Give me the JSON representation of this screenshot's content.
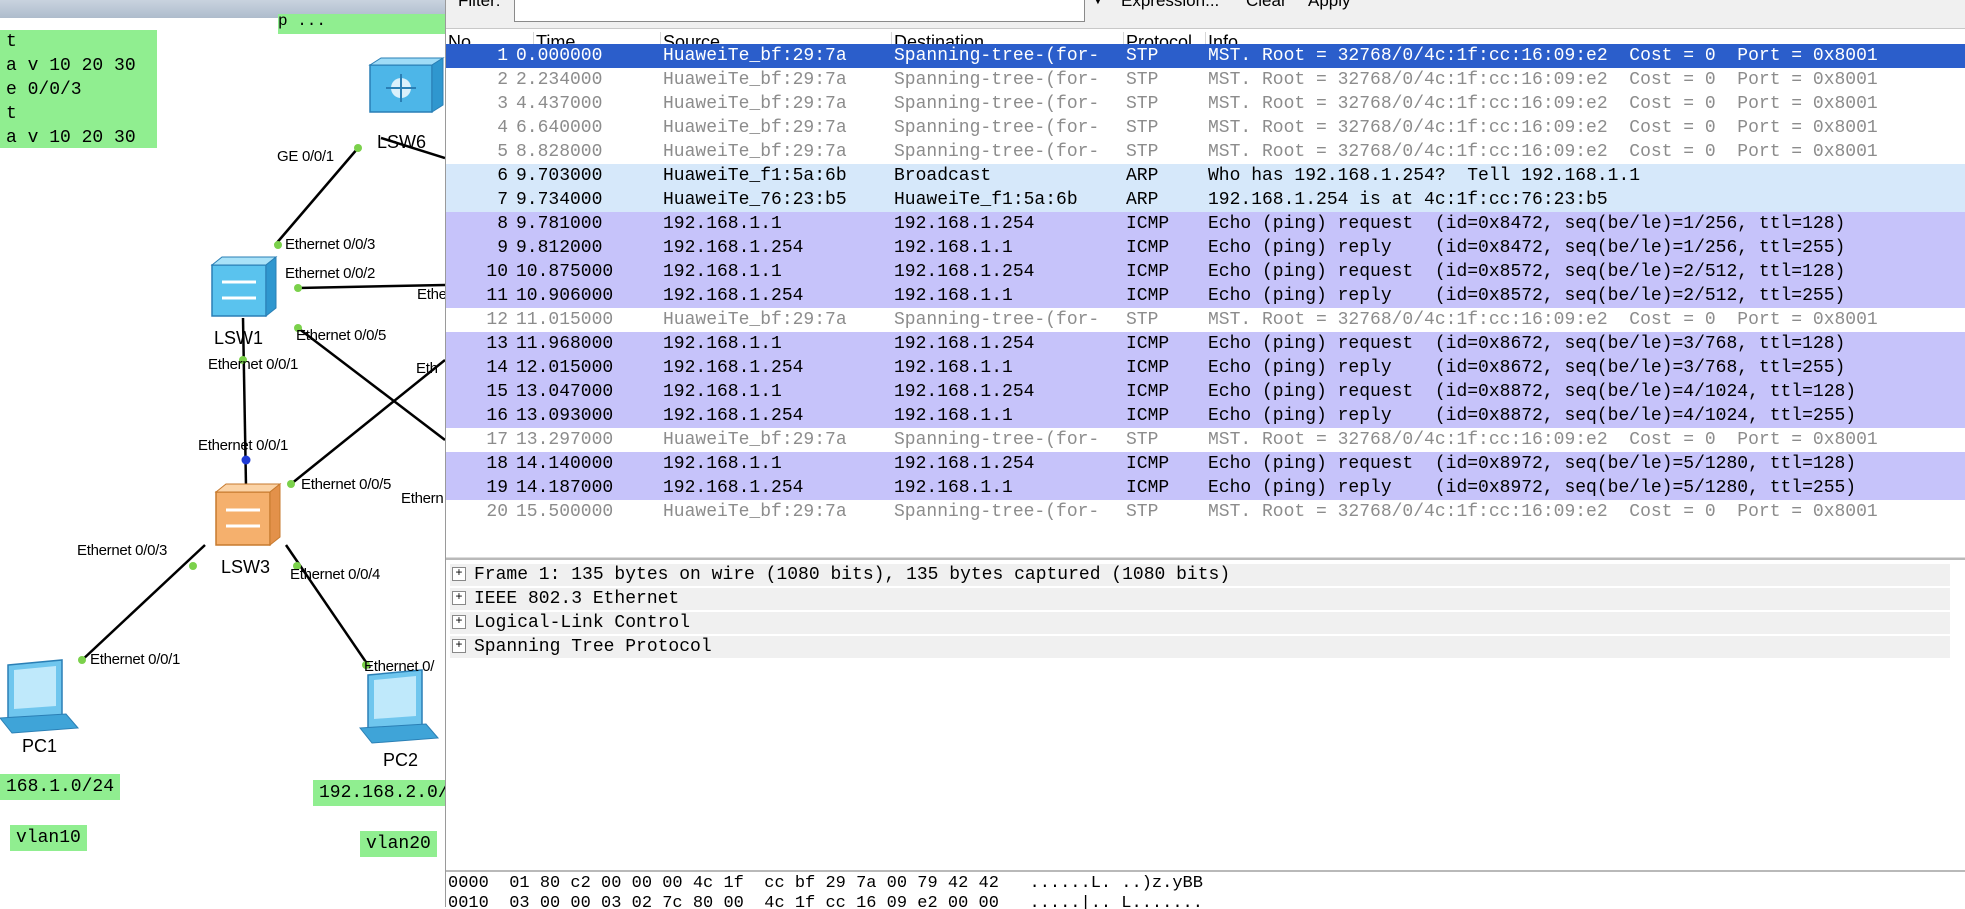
{
  "topology": {
    "config_note_lines": [
      "t",
      "a v 10 20 30",
      "e 0/0/3",
      "t",
      "a v 10 20 30"
    ],
    "top_note": "p ...",
    "devices": {
      "lsw6": "LSW6",
      "lsw1": "LSW1",
      "lsw3": "LSW3",
      "pc1": "PC1",
      "pc2": "PC2"
    },
    "ports": {
      "ge001": "GE 0/0/1",
      "lsw1_e003": "Ethernet 0/0/3",
      "lsw1_e002": "Ethernet 0/0/2",
      "lsw1_e005": "Ethernet 0/0/5",
      "lsw1_e001": "Ethernet 0/0/1",
      "lsw3_e001": "Ethernet 0/0/1",
      "lsw3_e005": "Ethernet 0/0/5",
      "lsw3_e003": "Ethernet 0/0/3",
      "lsw3_e004": "Ethernet 0/0/4",
      "pc1_e001": "Ethernet 0/0/1",
      "pc2_e0": "Ethernet 0/",
      "cut1": "Ethe",
      "cut2": "Eth",
      "cut3": "Ethern"
    },
    "nets": {
      "pc1_net": "168.1.0/24",
      "pc2_net": "192.168.2.0/",
      "vlan10": "vlan10",
      "vlan20": "vlan20"
    }
  },
  "filter": {
    "label": "Filter:",
    "value": "",
    "expression": "Expression...",
    "clear": "Clear",
    "apply": "Apply"
  },
  "columns": {
    "no": "No.",
    "time": "Time",
    "source": "Source",
    "destination": "Destination",
    "protocol": "Protocol",
    "info": "Info"
  },
  "packets": [
    {
      "no": "1",
      "time": "0.000000",
      "src": "HuaweiTe_bf:29:7a",
      "dst": "Spanning-tree-(for-",
      "proto": "STP",
      "info": "MST. Root = 32768/0/4c:1f:cc:16:09:e2  Cost = 0  Port = 0x8001",
      "kind": "selected"
    },
    {
      "no": "2",
      "time": "2.234000",
      "src": "HuaweiTe_bf:29:7a",
      "dst": "Spanning-tree-(for-",
      "proto": "STP",
      "info": "MST. Root = 32768/0/4c:1f:cc:16:09:e2  Cost = 0  Port = 0x8001",
      "kind": "stp"
    },
    {
      "no": "3",
      "time": "4.437000",
      "src": "HuaweiTe_bf:29:7a",
      "dst": "Spanning-tree-(for-",
      "proto": "STP",
      "info": "MST. Root = 32768/0/4c:1f:cc:16:09:e2  Cost = 0  Port = 0x8001",
      "kind": "stp"
    },
    {
      "no": "4",
      "time": "6.640000",
      "src": "HuaweiTe_bf:29:7a",
      "dst": "Spanning-tree-(for-",
      "proto": "STP",
      "info": "MST. Root = 32768/0/4c:1f:cc:16:09:e2  Cost = 0  Port = 0x8001",
      "kind": "stp"
    },
    {
      "no": "5",
      "time": "8.828000",
      "src": "HuaweiTe_bf:29:7a",
      "dst": "Spanning-tree-(for-",
      "proto": "STP",
      "info": "MST. Root = 32768/0/4c:1f:cc:16:09:e2  Cost = 0  Port = 0x8001",
      "kind": "stp"
    },
    {
      "no": "6",
      "time": "9.703000",
      "src": "HuaweiTe_f1:5a:6b",
      "dst": "Broadcast",
      "proto": "ARP",
      "info": "Who has 192.168.1.254?  Tell 192.168.1.1",
      "kind": "arp"
    },
    {
      "no": "7",
      "time": "9.734000",
      "src": "HuaweiTe_76:23:b5",
      "dst": "HuaweiTe_f1:5a:6b",
      "proto": "ARP",
      "info": "192.168.1.254 is at 4c:1f:cc:76:23:b5",
      "kind": "arp"
    },
    {
      "no": "8",
      "time": "9.781000",
      "src": "192.168.1.1",
      "dst": "192.168.1.254",
      "proto": "ICMP",
      "info": "Echo (ping) request  (id=0x8472, seq(be/le)=1/256, ttl=128)",
      "kind": "icmp"
    },
    {
      "no": "9",
      "time": "9.812000",
      "src": "192.168.1.254",
      "dst": "192.168.1.1",
      "proto": "ICMP",
      "info": "Echo (ping) reply    (id=0x8472, seq(be/le)=1/256, ttl=255)",
      "kind": "icmp"
    },
    {
      "no": "10",
      "time": "10.875000",
      "src": "192.168.1.1",
      "dst": "192.168.1.254",
      "proto": "ICMP",
      "info": "Echo (ping) request  (id=0x8572, seq(be/le)=2/512, ttl=128)",
      "kind": "icmp"
    },
    {
      "no": "11",
      "time": "10.906000",
      "src": "192.168.1.254",
      "dst": "192.168.1.1",
      "proto": "ICMP",
      "info": "Echo (ping) reply    (id=0x8572, seq(be/le)=2/512, ttl=255)",
      "kind": "icmp"
    },
    {
      "no": "12",
      "time": "11.015000",
      "src": "HuaweiTe_bf:29:7a",
      "dst": "Spanning-tree-(for-",
      "proto": "STP",
      "info": "MST. Root = 32768/0/4c:1f:cc:16:09:e2  Cost = 0  Port = 0x8001",
      "kind": "stp"
    },
    {
      "no": "13",
      "time": "11.968000",
      "src": "192.168.1.1",
      "dst": "192.168.1.254",
      "proto": "ICMP",
      "info": "Echo (ping) request  (id=0x8672, seq(be/le)=3/768, ttl=128)",
      "kind": "icmp"
    },
    {
      "no": "14",
      "time": "12.015000",
      "src": "192.168.1.254",
      "dst": "192.168.1.1",
      "proto": "ICMP",
      "info": "Echo (ping) reply    (id=0x8672, seq(be/le)=3/768, ttl=255)",
      "kind": "icmp"
    },
    {
      "no": "15",
      "time": "13.047000",
      "src": "192.168.1.1",
      "dst": "192.168.1.254",
      "proto": "ICMP",
      "info": "Echo (ping) request  (id=0x8872, seq(be/le)=4/1024, ttl=128)",
      "kind": "icmp"
    },
    {
      "no": "16",
      "time": "13.093000",
      "src": "192.168.1.254",
      "dst": "192.168.1.1",
      "proto": "ICMP",
      "info": "Echo (ping) reply    (id=0x8872, seq(be/le)=4/1024, ttl=255)",
      "kind": "icmp"
    },
    {
      "no": "17",
      "time": "13.297000",
      "src": "HuaweiTe_bf:29:7a",
      "dst": "Spanning-tree-(for-",
      "proto": "STP",
      "info": "MST. Root = 32768/0/4c:1f:cc:16:09:e2  Cost = 0  Port = 0x8001",
      "kind": "stp"
    },
    {
      "no": "18",
      "time": "14.140000",
      "src": "192.168.1.1",
      "dst": "192.168.1.254",
      "proto": "ICMP",
      "info": "Echo (ping) request  (id=0x8972, seq(be/le)=5/1280, ttl=128)",
      "kind": "icmp"
    },
    {
      "no": "19",
      "time": "14.187000",
      "src": "192.168.1.254",
      "dst": "192.168.1.1",
      "proto": "ICMP",
      "info": "Echo (ping) reply    (id=0x8972, seq(be/le)=5/1280, ttl=255)",
      "kind": "icmp"
    },
    {
      "no": "20",
      "time": "15.500000",
      "src": "HuaweiTe_bf:29:7a",
      "dst": "Spanning-tree-(for-",
      "proto": "STP",
      "info": "MST. Root = 32768/0/4c:1f:cc:16:09:e2  Cost = 0  Port = 0x8001",
      "kind": "stp"
    }
  ],
  "details": [
    "Frame 1: 135 bytes on wire (1080 bits), 135 bytes captured (1080 bits)",
    "IEEE 802.3 Ethernet",
    "Logical-Link Control",
    "Spanning Tree Protocol"
  ],
  "hex": {
    "line1": "0000  01 80 c2 00 00 00 4c 1f  cc bf 29 7a 00 79 42 42   ......L. ..)z.yBB",
    "line2": "0010  03 00 00 03 02 7c 80 00  4c 1f cc 16 09 e2 00 00   .....|.. L......."
  },
  "colors": {
    "selected": "#2b5ecb",
    "arp": "#d6e8fa",
    "icmp": "#c6c3fa",
    "note_green": "#90ee90"
  }
}
